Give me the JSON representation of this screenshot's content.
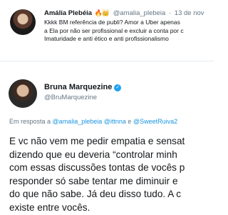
{
  "tweet1": {
    "name": "Amália Plebéia",
    "emoji": "🔥👑",
    "handle": "@amalia_plebeia",
    "dot": "·",
    "date": "13 de nov",
    "lines": [
      "Kkkk BM referência de publi? Amor a Uber apenas",
      "a Ela  por não ser profissional e excluir a conta por c",
      "Imaturidade e anti ético e anti profissionalismo"
    ]
  },
  "tweet2": {
    "name": "Bruna Marquezine",
    "verified_icon": "✓",
    "handle": "@BruMarquezine",
    "reply_prefix": "Em resposta a",
    "mention1": "@amalia_plebeia",
    "mention2": "@ittnna",
    "reply_and": "e",
    "mention3": "@SweetRuiva2",
    "lines": [
      "E vc não vem me pedir empatia e sensat",
      "dizendo que eu deveria “controlar minh",
      "com essas discussões tontas de vocês p",
      "responder só sabe tentar me diminuir e",
      "do que não sabe. Já deu disso tudo. A c",
      "existe entre vocês."
    ]
  }
}
